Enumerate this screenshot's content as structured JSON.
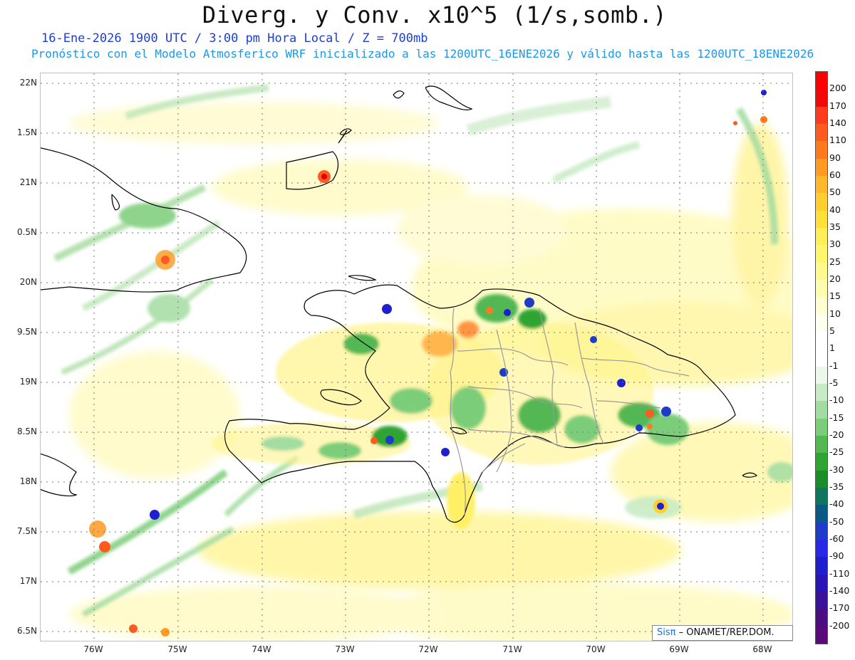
{
  "header": {
    "title": "Diverg. y Conv. x10^5 (1/s,somb.)",
    "subtitle1": "16-Ene-2026  1900 UTC / 3:00 pm Hora Local / Z = 700mb",
    "subtitle2": "Pronóstico con el Modelo Atmosferico WRF inicializado a las 1200UTC_16ENE2026 y válido hasta las  1200UTC_18ENE2026"
  },
  "lat_labels": [
    "22N",
    "1.5N",
    "21N",
    "0.5N",
    "20N",
    "9.5N",
    "19N",
    "8.5N",
    "18N",
    "7.5N",
    "17N",
    "6.5N"
  ],
  "lon_labels": [
    "76W",
    "75W",
    "74W",
    "73W",
    "72W",
    "71W",
    "70W",
    "69W",
    "68W"
  ],
  "colorbar": {
    "labels": [
      "200",
      "170",
      "140",
      "110",
      "90",
      "60",
      "50",
      "40",
      "35",
      "30",
      "25",
      "20",
      "15",
      "10",
      "5",
      "1",
      "-1",
      "-5",
      "-10",
      "-15",
      "-20",
      "-25",
      "-30",
      "-35",
      "-40",
      "-50",
      "-60",
      "-90",
      "-110",
      "-140",
      "-170",
      "-200"
    ],
    "colors": [
      "#ff0000",
      "#f20a0a",
      "#ff3b1f",
      "#ff5a1f",
      "#ff7a1f",
      "#ff9a22",
      "#ffb82a",
      "#ffcf30",
      "#ffe13a",
      "#ffee55",
      "#fff66e",
      "#fffa8f",
      "#fffcb0",
      "#fffed2",
      "#fffff0",
      "#ffffff",
      "#ffffff",
      "#eef8ea",
      "#c7ebc4",
      "#a3dca0",
      "#7ccd79",
      "#52b852",
      "#2ea433",
      "#1a8c2a",
      "#0d7560",
      "#0a5a88",
      "#1e3cc8",
      "#2828e6",
      "#1f1fd0",
      "#2a16b8",
      "#3a1298",
      "#4b0f82",
      "#5a0a7a"
    ]
  },
  "credit": {
    "logo": "Sisπ",
    "text": "– ONAMET/REP.DOM."
  }
}
